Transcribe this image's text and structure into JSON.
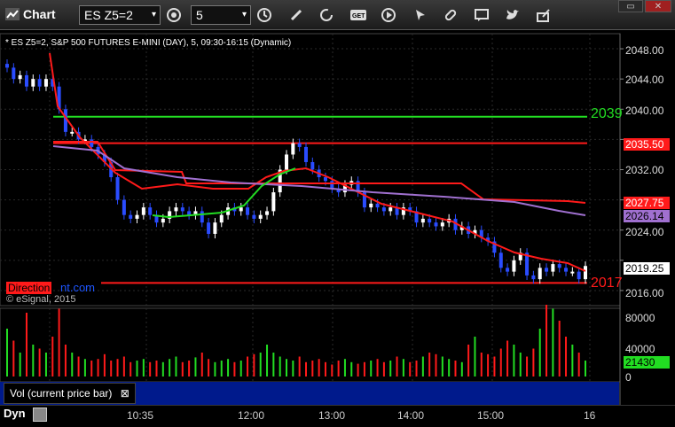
{
  "window": {
    "title": "Chart",
    "ctrl_restore": "▭",
    "ctrl_close": "✕"
  },
  "toolbar": {
    "symbol": "ES Z5=2",
    "interval": "5",
    "icons": [
      "settings-icon",
      "clock-icon",
      "pencil-icon",
      "refresh-icon",
      "get-icon",
      "play-icon",
      "link-icon",
      "chat-icon",
      "twitter-icon",
      "share-icon"
    ]
  },
  "chart_header": "* ES Z5=2, S&P 500 FUTURES E-MINI (DAY), 5, 09:30-16:15 (Dynamic)",
  "watermark": "© eSignal, 2015",
  "direction_label": "Direction",
  "direction_suffix": "nt.com",
  "price_axis": [
    "2048.00",
    "2044.00",
    "2040.00",
    "2036.00",
    "2032.00",
    "2028.00",
    "2024.00",
    "2020.00",
    "2016.00"
  ],
  "price_tags": {
    "top_line": "2039",
    "red_line": "2035.50",
    "ma_red": "2027.75",
    "ma_purple": "2026.14",
    "last": "2019.25",
    "bottom_line": "2017"
  },
  "volume_axis": [
    "80000",
    "40000",
    "0"
  ],
  "volume_tag": "21430",
  "volume_label": "Vol (current price bar)",
  "volume_close": "⊠",
  "time_axis": [
    "10:35",
    "12:00",
    "13:00",
    "14:00",
    "15:00",
    "16"
  ],
  "bottom_label": "Dyn",
  "colors": {
    "up": "#ffffff",
    "down": "#2a4cff",
    "green": "#22dd22",
    "red": "#ff1a1a",
    "purple": "#a070d0"
  },
  "chart_data": {
    "type": "candlestick",
    "price_range": [
      2014,
      2050
    ],
    "levels": {
      "top_line": 2039,
      "red_line": 2035.5,
      "bottom_line": 2017
    },
    "last_price": 2019.25,
    "ma_red_last": 2027.75,
    "ma_purple_last": 2026.14,
    "last_volume": 21430
  }
}
